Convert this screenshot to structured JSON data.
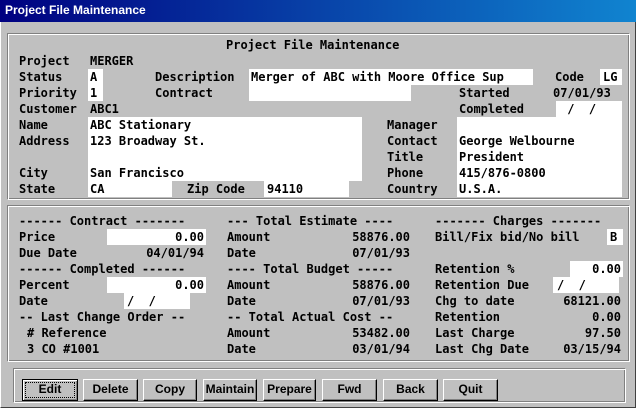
{
  "window": {
    "title": "Project File Maintenance"
  },
  "header": {
    "title": "Project File Maintenance",
    "project_label": "Project",
    "project_value": "MERGER",
    "status_label": "Status",
    "status_value": "A",
    "description_label": "Description",
    "description_value": "Merger of ABC with Moore Office Sup",
    "code_label": "Code",
    "code_value": "LG",
    "priority_label": "Priority",
    "priority_value": "1",
    "contract_label": "Contract",
    "contract_value": "",
    "started_label": "Started",
    "started_value": "07/01/93",
    "customer_label": "Customer",
    "customer_value": "ABC1",
    "completed_label": "Completed",
    "completed_value": " /  /",
    "name_label": "Name",
    "name_value": "ABC Stationary",
    "manager_label": "Manager",
    "manager_value": "",
    "address_label": "Address",
    "address1_value": "123 Broadway St.",
    "address2_value": "",
    "contact_label": "Contact",
    "contact_value": "George Welbourne",
    "title_label": "Title",
    "title_value": "President",
    "city_label": "City",
    "city_value": "San Francisco",
    "phone_label": "Phone",
    "phone_value": "415/876-0800",
    "state_label": "State",
    "state_value": "CA",
    "zip_label": "Zip Code",
    "zip_value": "94110",
    "country_label": "Country",
    "country_value": "U.S.A."
  },
  "detail": {
    "contract_heading": "------ Contract -------",
    "price_label": "Price",
    "price_value": "0.00",
    "due_label": "Due Date",
    "due_value": "04/01/94",
    "completed_heading": "------ Completed ------",
    "percent_label": "Percent",
    "percent_value": "0.00",
    "cdate_label": "Date",
    "cdate_value": "/  /",
    "lco_heading": "-- Last Change Order --",
    "ref_header": "# Reference",
    "ref_value": "3 CO #1001",
    "estimate_heading": "--- Total Estimate ----",
    "est_amount_label": "Amount",
    "est_amount_value": "58876.00",
    "est_date_label": "Date",
    "est_date_value": "07/01/93",
    "budget_heading": "---- Total Budget -----",
    "bud_amount_label": "Amount",
    "bud_amount_value": "58876.00",
    "bud_date_label": "Date",
    "bud_date_value": "07/01/93",
    "actual_heading": "-- Total Actual Cost --",
    "act_amount_label": "Amount",
    "act_amount_value": "53482.00",
    "act_date_label": "Date",
    "act_date_value": "03/01/94",
    "charges_heading": "------- Charges -------",
    "bill_label": "Bill/Fix bid/No bill",
    "bill_value": "B",
    "ret_pct_label": "Retention %",
    "ret_pct_value": "0.00",
    "ret_due_label": "Retention Due",
    "ret_due_value": "/  /",
    "chg_label": "Chg to date",
    "chg_value": "68121.00",
    "ret_label": "Retention",
    "ret_value": "0.00",
    "last_charge_label": "Last Charge",
    "last_charge_value": "97.50",
    "last_chg_date_label": "Last Chg Date",
    "last_chg_date_value": "03/15/94"
  },
  "toolbar": {
    "edit": "Edit",
    "delete": "Delete",
    "copy": "Copy",
    "maintain": "Maintain",
    "prepare": "Prepare",
    "fwd": "Fwd",
    "back": "Back",
    "quit": "Quit"
  }
}
